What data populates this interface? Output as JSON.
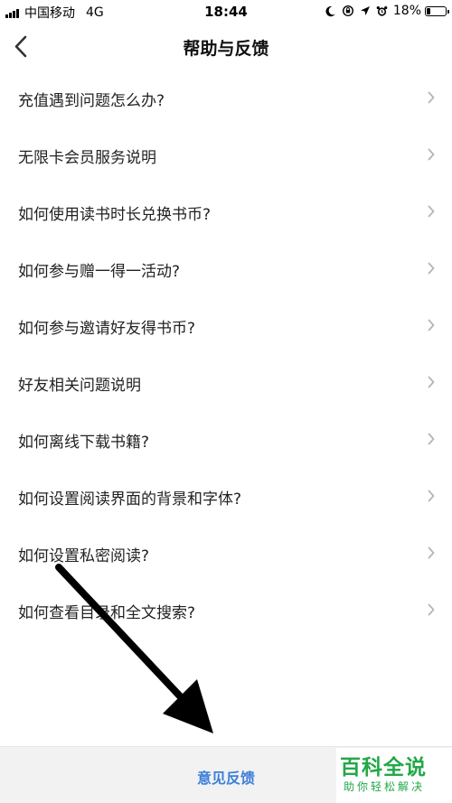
{
  "status_bar": {
    "carrier": "中国移动",
    "network": "4G",
    "time": "18:44",
    "battery": "18%",
    "battery_level": 0.18,
    "icons": [
      "moon-icon",
      "rotation-lock-icon",
      "location-icon",
      "alarm-icon"
    ]
  },
  "nav": {
    "title": "帮助与反馈",
    "back_icon": "chevron-left-icon"
  },
  "list": {
    "items": [
      {
        "label": "充值遇到问题怎么办?"
      },
      {
        "label": "无限卡会员服务说明"
      },
      {
        "label": "如何使用读书时长兑换书币?"
      },
      {
        "label": "如何参与赠一得一活动?"
      },
      {
        "label": "如何参与邀请好友得书币?"
      },
      {
        "label": "好友相关问题说明"
      },
      {
        "label": "如何离线下载书籍?"
      },
      {
        "label": "如何设置阅读界面的背景和字体?"
      },
      {
        "label": "如何设置私密阅读?"
      },
      {
        "label": "如何查看目录和全文搜索?"
      }
    ],
    "chevron_icon": "chevron-right-icon"
  },
  "bottom_bar": {
    "label": "意见反馈"
  },
  "watermark": {
    "main": "百科全说",
    "sub": "助你轻松解决"
  },
  "colors": {
    "accent": "#3c7fd9",
    "watermark": "#23a847",
    "annotation": "#000000"
  }
}
